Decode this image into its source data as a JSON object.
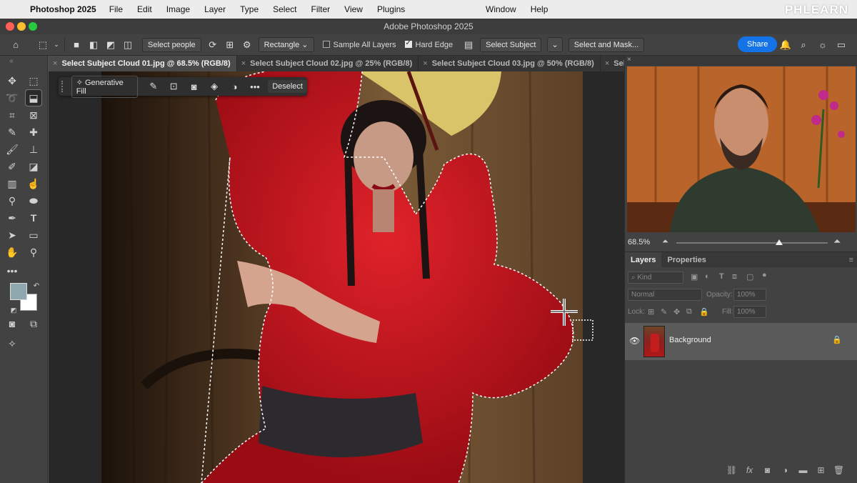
{
  "menubar": {
    "app_name": "Photoshop 2025",
    "menus": [
      "File",
      "Edit",
      "Image",
      "Layer",
      "Type",
      "Select",
      "Filter",
      "View",
      "Plugins"
    ],
    "right_menus": [
      "Window",
      "Help"
    ],
    "watermark": "PHLEARN"
  },
  "window": {
    "title": "Adobe Photoshop 2025"
  },
  "options_bar": {
    "select_people": "Select people",
    "shape_mode": "Rectangle",
    "sample_all_layers": "Sample All Layers",
    "hard_edge": "Hard Edge",
    "select_subject": "Select Subject",
    "select_and_mask": "Select and Mask...",
    "share": "Share"
  },
  "tabs": [
    {
      "label": "Select Subject Cloud 01.jpg @ 68.5% (RGB/8)",
      "active": true
    },
    {
      "label": "Select Subject Cloud 02.jpg @ 25% (RGB/8)",
      "active": false
    },
    {
      "label": "Select Subject Cloud 03.jpg @ 50% (RGB/8)",
      "active": false
    },
    {
      "label": "Select Subje",
      "active": false
    }
  ],
  "task_bar": {
    "generative_fill": "Generative Fill",
    "deselect": "Deselect"
  },
  "navigator": {
    "zoom": "68.5%",
    "zoom_fraction": 0.68
  },
  "layers_panel": {
    "tabs": [
      "Layers",
      "Properties"
    ],
    "kind_placeholder": "Kind",
    "blend_mode": "Normal",
    "opacity_label": "Opacity:",
    "opacity_value": "100%",
    "lock_label": "Lock:",
    "fill_label": "Fill:",
    "fill_value": "100%",
    "layers": [
      {
        "name": "Background",
        "visible": true,
        "locked": true
      }
    ]
  },
  "colors": {
    "foreground": "#8fa7ae",
    "background": "#ffffff",
    "accent": "#1473e6"
  }
}
